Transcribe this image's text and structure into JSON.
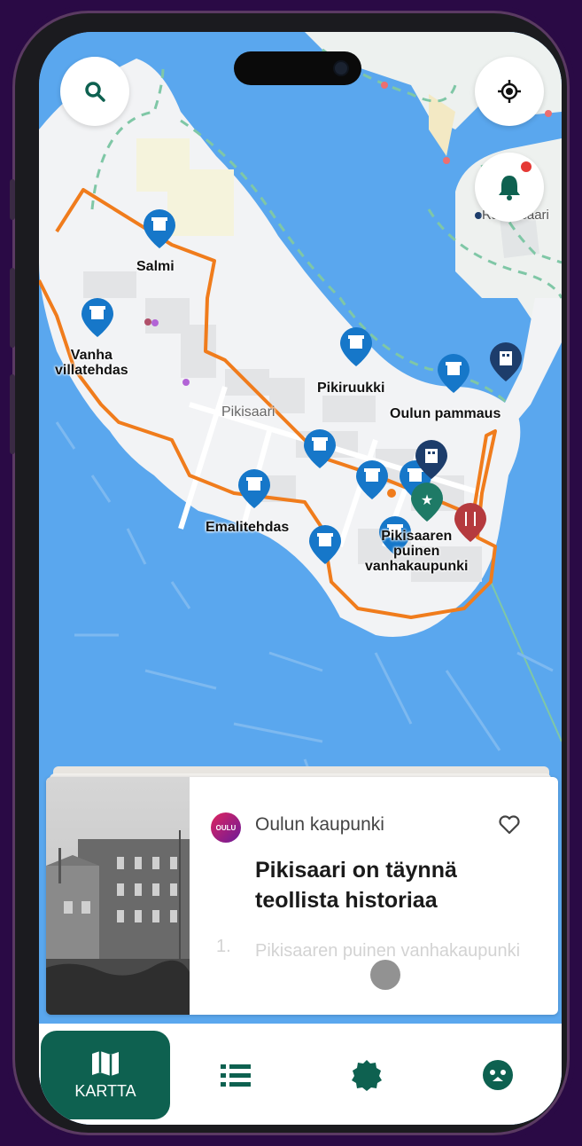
{
  "map": {
    "area_name": "Pikisaari",
    "places": [
      {
        "id": "salmi",
        "label": "Salmi"
      },
      {
        "id": "vanha",
        "label": "Vanha\nvillatehdas"
      },
      {
        "id": "pikiruukki",
        "label": "Pikiruukki"
      },
      {
        "id": "pammaus",
        "label": "Oulun pammaus"
      },
      {
        "id": "emali",
        "label": "Emalitehdas"
      },
      {
        "id": "vanhakaupunki",
        "label": "Pikisaaren\npuinen\nvanhakaupunki"
      }
    ],
    "partial_label": "Raatinsaari",
    "colors": {
      "water": "#5aa7ee",
      "land": "#f2f3f5",
      "route": "#f07c1c",
      "pin": "#1677c9",
      "dark_pin": "#1d3d6b",
      "accent": "#0e6150",
      "food_pin": "#b53a3e"
    }
  },
  "controls": {
    "search": {
      "icon": "search-icon"
    },
    "locate": {
      "icon": "locate-icon"
    },
    "notify": {
      "icon": "bell-icon"
    }
  },
  "card": {
    "org_logo_text": "OULU",
    "org": "Oulun kaupunki",
    "title": "Pikisaari on täynnä teollista historiaa",
    "list_number": "1.",
    "list_text": "Pikisaaren puinen vanhakaupunki"
  },
  "tabs": [
    {
      "id": "map",
      "label": "KARTTA",
      "icon": "map-icon",
      "active": true
    },
    {
      "id": "list",
      "label": "",
      "icon": "list-icon",
      "active": false
    },
    {
      "id": "badge",
      "label": "",
      "icon": "badge-icon",
      "active": false
    },
    {
      "id": "profile",
      "label": "",
      "icon": "profile-icon",
      "active": false
    }
  ]
}
